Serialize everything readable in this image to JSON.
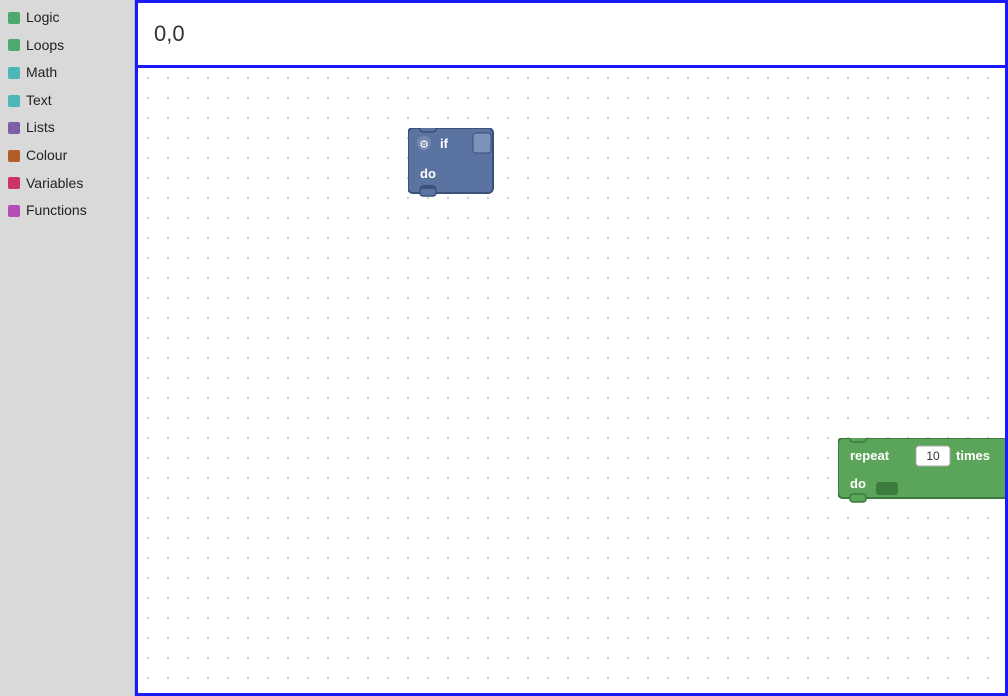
{
  "sidebar": {
    "items": [
      {
        "label": "Logic",
        "color": "#4da96e"
      },
      {
        "label": "Loops",
        "color": "#4da96e"
      },
      {
        "label": "Math",
        "color": "#4db6b6"
      },
      {
        "label": "Text",
        "color": "#4db6b6"
      },
      {
        "label": "Lists",
        "color": "#7c5fa6"
      },
      {
        "label": "Colour",
        "color": "#b05e26"
      },
      {
        "label": "Variables",
        "color": "#cc3366"
      },
      {
        "label": "Functions",
        "color": "#b44db5"
      }
    ]
  },
  "coord_bar": {
    "text": "0,0"
  },
  "if_block": {
    "label_if": "if",
    "label_do": "do"
  },
  "repeat_block": {
    "label_repeat": "repeat",
    "label_times": "times",
    "label_do": "do",
    "value": "10"
  }
}
